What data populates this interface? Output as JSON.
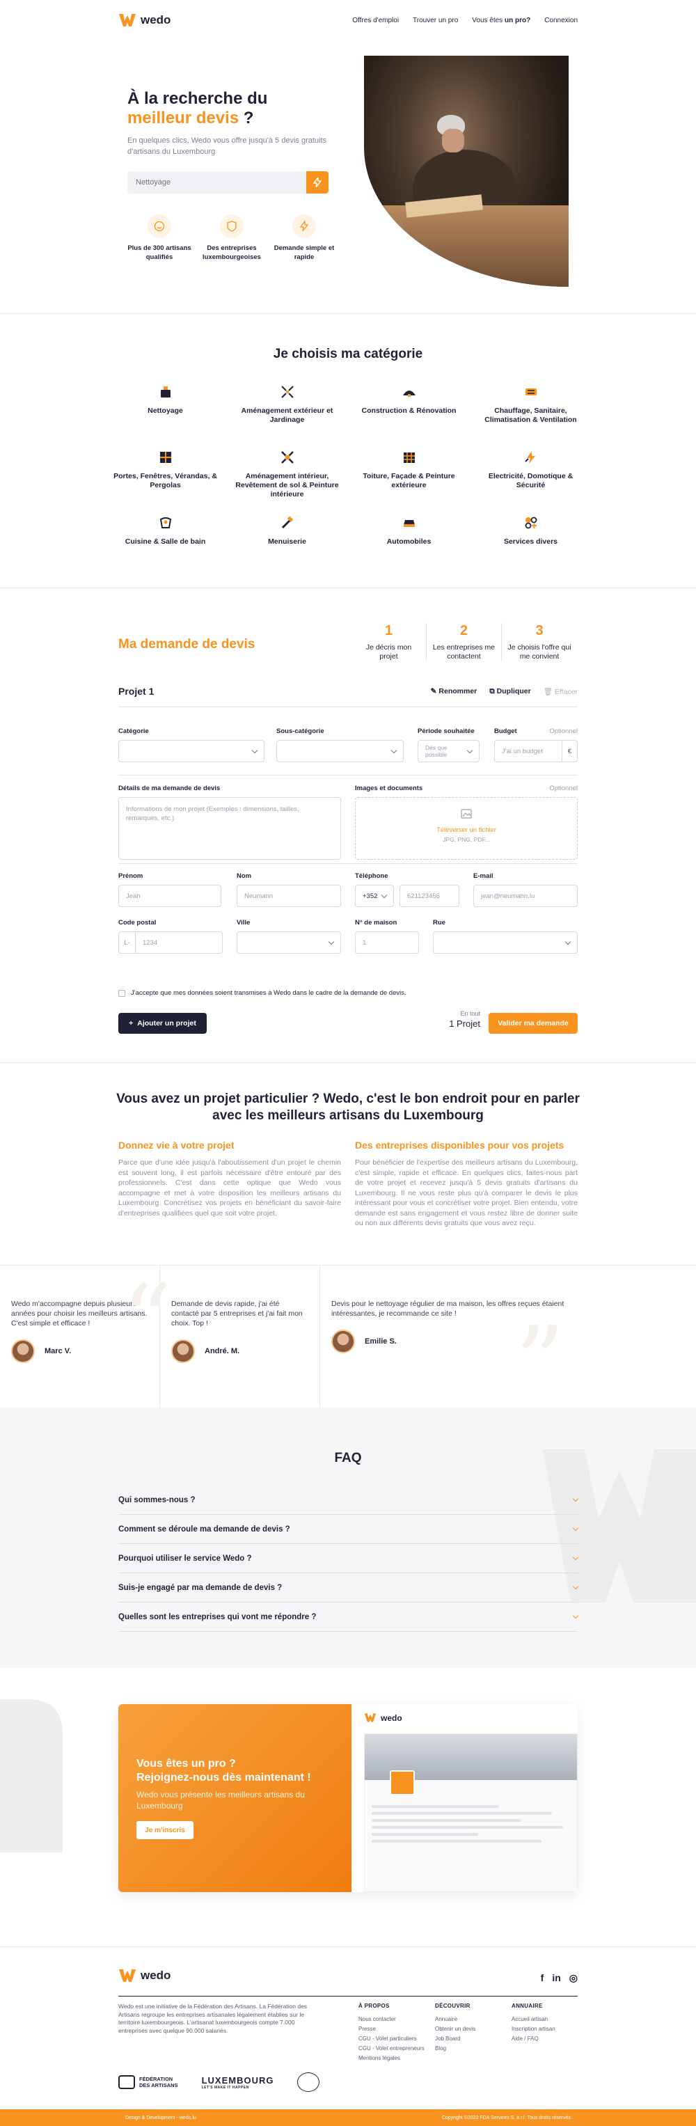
{
  "header": {
    "brand": "wedo",
    "nav": [
      "Offres d'emploi",
      "Trouver un pro"
    ],
    "nav_pro_prefix": "Vous êtes ",
    "nav_pro_bold": "un pro?",
    "login": "Connexion"
  },
  "hero": {
    "title_line1": "À la recherche du",
    "title_highlight": "meilleur devis",
    "title_suffix": " ?",
    "subtitle": "En quelques clics, Wedo vous offre jusqu'à 5 devis gratuits d'artisans du Luxembourg",
    "search_placeholder": "Nettoyage",
    "features": [
      {
        "icon": "smiley-icon",
        "label": "Plus de 300 artisans qualifiés"
      },
      {
        "icon": "shield-icon",
        "label": "Des entreprises luxembourgeoises"
      },
      {
        "icon": "lightning-icon",
        "label": "Demande simple et rapide"
      }
    ]
  },
  "categories": {
    "title": "Je choisis ma catégorie",
    "items": [
      {
        "icon": "cleaning-icon",
        "label": "Nettoyage"
      },
      {
        "icon": "garden-icon",
        "label": "Aménagement extérieur et Jardinage"
      },
      {
        "icon": "construction-icon",
        "label": "Construction & Rénovation"
      },
      {
        "icon": "heating-icon",
        "label": "Chauffage, Sanitaire, Climatisation & Ventilation"
      },
      {
        "icon": "window-icon",
        "label": "Portes, Fenêtres, Vérandas, & Pergolas"
      },
      {
        "icon": "interior-icon",
        "label": "Aménagement intérieur, Revêtement de sol & Peinture intérieure"
      },
      {
        "icon": "roof-icon",
        "label": "Toiture, Façade & Peinture extérieure"
      },
      {
        "icon": "electricity-icon",
        "label": "Electricité, Domotique & Sécurité"
      },
      {
        "icon": "kitchen-icon",
        "label": "Cuisine & Salle de bain"
      },
      {
        "icon": "carpentry-icon",
        "label": "Menuiserie"
      },
      {
        "icon": "car-icon",
        "label": "Automobiles"
      },
      {
        "icon": "services-icon",
        "label": "Services divers"
      }
    ]
  },
  "quote": {
    "title": "Ma demande de devis",
    "steps": [
      {
        "num": "1",
        "label": "Je décris mon projet"
      },
      {
        "num": "2",
        "label": "Les entreprises me contactent"
      },
      {
        "num": "3",
        "label": "Je choisis l'offre qui me convient"
      }
    ],
    "project_name": "Projet 1",
    "actions": {
      "rename": "Renommer",
      "duplicate": "Dupliquer",
      "delete": "Effacer"
    },
    "fields": {
      "category": "Catégorie",
      "subcategory": "Sous-catégorie",
      "period": "Période souhaitée",
      "period_value": "Dès que possible",
      "budget": "Budget",
      "optional": "Optionnel",
      "budget_placeholder": "J'ai un budget",
      "currency": "€",
      "details": "Détails de ma demande de devis",
      "details_placeholder": "Informations de mon projet (Exemples : dimensions, tailles, remarques, etc.)",
      "images": "Images et documents",
      "upload": "Téléverser un fichier",
      "upload_formats": "JPG, PNG, PDF...",
      "firstname": "Prénom",
      "firstname_ph": "Jean",
      "lastname": "Nom",
      "lastname_ph": "Neumann",
      "phone": "Téléphone",
      "phone_prefix": "+352",
      "phone_ph": "621123456",
      "email": "E-mail",
      "email_ph": "jean@neumann.lu",
      "postal": "Code postal",
      "postal_prefix": "L-",
      "postal_ph": "1234",
      "city": "Ville",
      "house": "N° de maison",
      "house_ph": "1",
      "street": "Rue"
    },
    "consent": "J'accepte que mes données soient transmises à Wedo dans le cadre de la demande de devis.",
    "add_button": "Ajouter un projet",
    "total_label": "En tout",
    "total_value": "1 Projet",
    "submit": "Valider ma demande"
  },
  "about": {
    "title": "Vous avez un projet particulier ? Wedo, c'est le bon endroit pour en parler avec les meilleurs artisans du Luxembourg",
    "col1_title": "Donnez vie à votre projet",
    "col1_text": "Parce que d'une idée jusqu'à l'aboutissement d'un projet le chemin est souvent long, il est parfois nécessaire d'être entouré par des professionnels. C'est dans cette optique que Wedo vous accompagne et met à votre disposition les meilleurs artisans du Luxembourg. Concrétisez vos projets en bénéficiant du savoir-faire d'entreprises qualifiées quel que soit votre projet.",
    "col2_title": "Des entreprises disponibles pour vos projets",
    "col2_text": "Pour bénéficier de l'expertise des meilleurs artisans du Luxembourg, c'est simple, rapide et efficace. En quelques clics, faites-nous part de votre projet et recevez jusqu'à 5 devis gratuits d'artisans du Luxembourg. Il ne vous reste plus qu'à comparer le devis le plus intéressant pour vous et concrétiser votre projet. Bien entendu, votre demande est sans engagement et vous restez libre de donner suite ou non aux différents devis gratuits que vous avez reçu."
  },
  "testimonials": [
    {
      "quote": "Wedo m'accompagne depuis plusieurs années pour choisir les meilleurs artisans. C'est simple et efficace !",
      "author": "Marc V."
    },
    {
      "quote": "Demande de devis rapide, j'ai été contacté par 5 entreprises et j'ai fait mon choix. Top !",
      "author": "André. M."
    },
    {
      "quote": "Devis pour le nettoyage régulier de ma maison, les offres reçues étaient intéressantes, je recommande ce site !",
      "author": "Emilie S."
    }
  ],
  "faq": {
    "title": "FAQ",
    "items": [
      "Qui sommes-nous ?",
      "Comment se déroule ma demande de devis ?",
      "Pourquoi utiliser le service Wedo ?",
      "Suis-je engagé par ma demande de devis ?",
      "Quelles sont les entreprises qui vont me répondre ?"
    ]
  },
  "pro": {
    "line1": "Vous êtes un pro ?",
    "line2": "Rejoignez-nous dès maintenant !",
    "text": "Wedo vous présente les meilleurs artisans du Luxembourg",
    "button": "Je m'inscris",
    "mock_brand": "wedo"
  },
  "footer": {
    "brand": "wedo",
    "about": "Wedo est une initiative de la Fédération des Artisans. La Fédération des Artisans regroupe les entreprises artisanales légalement établies sur le territoire luxembourgeois. L'artisanat luxembourgeois compte 7.000 entreprises avec quelque 90.000 salariés.",
    "columns": [
      {
        "title": "À PROPOS",
        "links": [
          "Nous contacter",
          "Presse",
          "CGU - Volet particuliers",
          "CGU - Volet entrepreneurs",
          "Mentions légales"
        ]
      },
      {
        "title": "DÉCOUVRIR",
        "links": [
          "Annuaire",
          "Obtenir un devis",
          "Job Board",
          "Blog"
        ]
      },
      {
        "title": "ANNUAIRE",
        "links": [
          "Accueil artisan",
          "Inscription artisan",
          "Aide / FAQ"
        ]
      }
    ],
    "partners": {
      "fed_line1": "FÉDÉRATION",
      "fed_line2": "DES ARTISANS",
      "lux": "LUXEMBOURG",
      "lux_tag": "LET'S MAKE IT HAPPEN"
    },
    "credit": "Design & Development - wedo.lu",
    "copyright": "Copyright ©2022 FDA Services S. à r.l. Tous droits réservés",
    "social": [
      "f",
      "in",
      "◎"
    ]
  },
  "colors": {
    "accent": "#f7931e",
    "dark": "#1f2236"
  }
}
